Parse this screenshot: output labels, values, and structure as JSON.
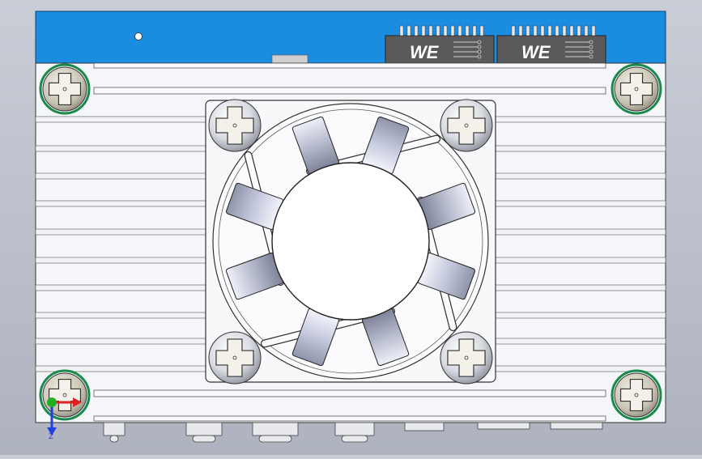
{
  "viewport": {
    "background_colors": [
      "#c9cdd6",
      "#aeb3bf"
    ],
    "pcb_color": "#1a8de0",
    "heatsink_color": "#f4f6f9"
  },
  "connectors": [
    {
      "logo": "WE"
    },
    {
      "logo": "WE"
    }
  ],
  "triad": {
    "z_label": "Z",
    "x_color": "#e02020",
    "y_color": "#20b020",
    "z_color": "#2040e0"
  },
  "icons": {
    "mount_screw": "phillips-screw-icon",
    "fan_screw": "fan-screw-icon",
    "fan": "fan-icon"
  }
}
